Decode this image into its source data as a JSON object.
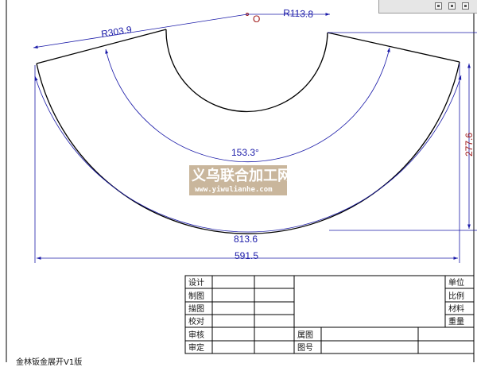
{
  "window": {
    "panel_icons": [
      "grid-view-icon",
      "export-icon",
      "settings-icon"
    ]
  },
  "drawing": {
    "center_label": "O",
    "dimensions": {
      "outer_radius": "R303.9",
      "inner_radius": "R113.8",
      "sector_angle": "153.3°",
      "arc_length": "813.6",
      "chord_width": "591.5",
      "height": "277.6"
    },
    "colors": {
      "outline": "#000000",
      "dimension": "#1a1aa8",
      "center_mark": "#a01818",
      "watermark_bg": "#bfa98b"
    }
  },
  "watermark": {
    "title": "义乌联合加工网",
    "url": "www.yiwulianhe.com"
  },
  "title_block": {
    "left_labels": [
      "设计",
      "制图",
      "描图",
      "校对",
      "审核",
      "审定"
    ],
    "right_labels": [
      "单位",
      "比例",
      "材料",
      "重量"
    ],
    "middle_labels": [
      "属图",
      "图号"
    ]
  },
  "bottom_caption": "金林钣金展开V1版"
}
